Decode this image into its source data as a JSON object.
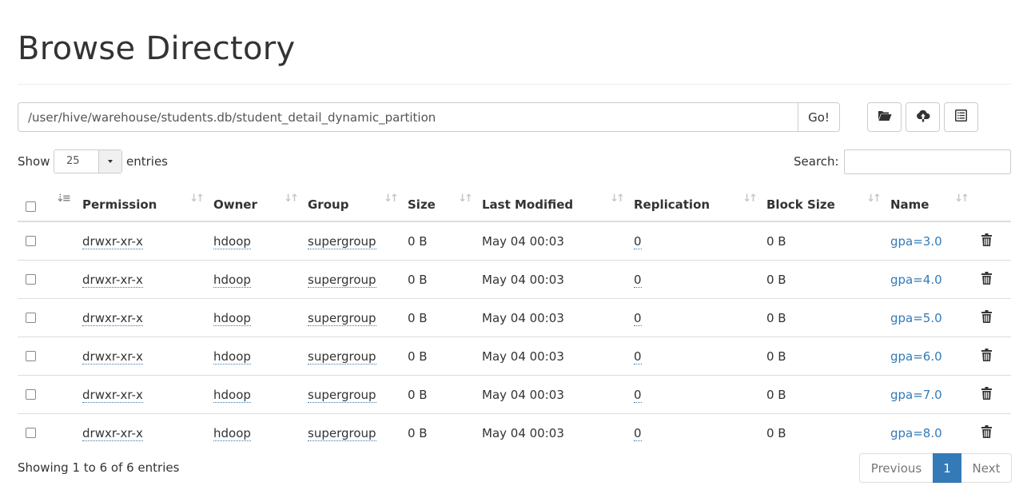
{
  "page": {
    "title": "Browse Directory"
  },
  "path": {
    "value": "/user/hive/warehouse/students.db/student_detail_dynamic_partition",
    "go_label": "Go!"
  },
  "toolbar": {
    "icons": [
      "folder-open-icon",
      "cloud-upload-icon",
      "list-alt-icon"
    ]
  },
  "length": {
    "show": "Show",
    "value": "25",
    "entries": "entries"
  },
  "search": {
    "label": "Search:",
    "value": ""
  },
  "table": {
    "headers": [
      "Permission",
      "Owner",
      "Group",
      "Size",
      "Last Modified",
      "Replication",
      "Block Size",
      "Name"
    ],
    "rows": [
      {
        "permission": "drwxr-xr-x",
        "owner": "hdoop",
        "group": "supergroup",
        "size": "0 B",
        "modified": "May 04 00:03",
        "replication": "0",
        "block_size": "0 B",
        "name": "gpa=3.0"
      },
      {
        "permission": "drwxr-xr-x",
        "owner": "hdoop",
        "group": "supergroup",
        "size": "0 B",
        "modified": "May 04 00:03",
        "replication": "0",
        "block_size": "0 B",
        "name": "gpa=4.0"
      },
      {
        "permission": "drwxr-xr-x",
        "owner": "hdoop",
        "group": "supergroup",
        "size": "0 B",
        "modified": "May 04 00:03",
        "replication": "0",
        "block_size": "0 B",
        "name": "gpa=5.0"
      },
      {
        "permission": "drwxr-xr-x",
        "owner": "hdoop",
        "group": "supergroup",
        "size": "0 B",
        "modified": "May 04 00:03",
        "replication": "0",
        "block_size": "0 B",
        "name": "gpa=6.0"
      },
      {
        "permission": "drwxr-xr-x",
        "owner": "hdoop",
        "group": "supergroup",
        "size": "0 B",
        "modified": "May 04 00:03",
        "replication": "0",
        "block_size": "0 B",
        "name": "gpa=7.0"
      },
      {
        "permission": "drwxr-xr-x",
        "owner": "hdoop",
        "group": "supergroup",
        "size": "0 B",
        "modified": "May 04 00:03",
        "replication": "0",
        "block_size": "0 B",
        "name": "gpa=8.0"
      }
    ]
  },
  "footer": {
    "info": "Showing 1 to 6 of 6 entries",
    "previous": "Previous",
    "current": "1",
    "next": "Next"
  },
  "colors": {
    "link": "#337ab7",
    "active_page": "#337ab7",
    "border": "#dddddd"
  }
}
